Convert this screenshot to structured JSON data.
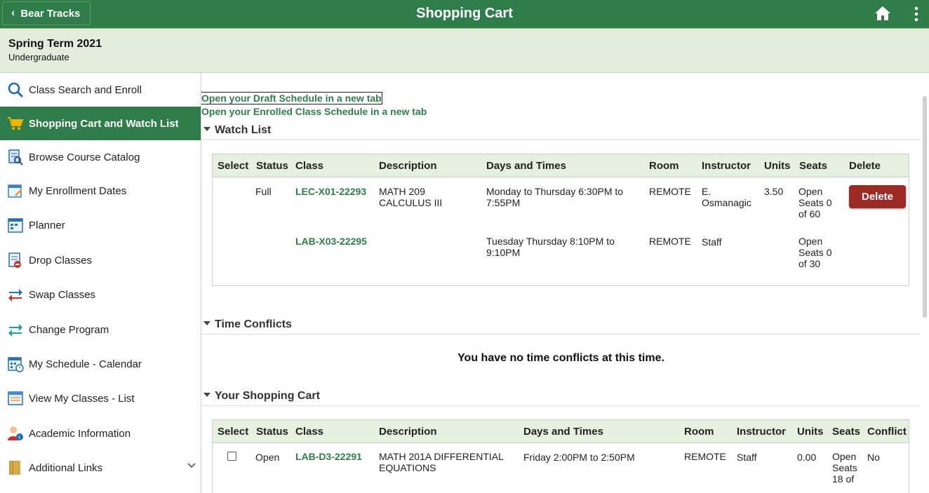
{
  "header": {
    "back_label": "Bear Tracks",
    "title": "Shopping Cart"
  },
  "term": {
    "name": "Spring Term 2021",
    "career": "Undergraduate"
  },
  "sidebar": {
    "items": [
      {
        "label": "Class Search and Enroll",
        "icon": "search-icon"
      },
      {
        "label": "Shopping Cart and Watch List",
        "icon": "shopping-cart-icon",
        "active": true
      },
      {
        "label": "Browse Course Catalog",
        "icon": "catalog-icon"
      },
      {
        "label": "My Enrollment Dates",
        "icon": "enrollment-dates-icon"
      },
      {
        "label": "Planner",
        "icon": "planner-icon"
      },
      {
        "label": "Drop Classes",
        "icon": "drop-classes-icon"
      },
      {
        "label": "Swap Classes",
        "icon": "swap-icon"
      },
      {
        "label": "Change Program",
        "icon": "change-program-icon"
      },
      {
        "label": "My Schedule - Calendar",
        "icon": "calendar-icon"
      },
      {
        "label": "View My Classes - List",
        "icon": "class-list-icon"
      },
      {
        "label": "Academic Information",
        "icon": "academic-info-icon"
      },
      {
        "label": "Additional Links",
        "icon": "folder-icon"
      }
    ]
  },
  "links": {
    "draft": "Open your Draft Schedule in a new tab",
    "enrolled": "Open your Enrolled Class Schedule in a new tab"
  },
  "watch_list": {
    "title": "Watch List",
    "columns": [
      "Select",
      "Status",
      "Class",
      "Description",
      "Days and Times",
      "Room",
      "Instructor",
      "Units",
      "Seats",
      "Delete"
    ],
    "rows": [
      {
        "status": "Full",
        "class": "LEC-X01-22293",
        "description": "MATH 209 CALCULUS III",
        "days_times": "Monday to Thursday  6:30PM to 7:55PM",
        "room": "REMOTE",
        "instructor": "E. Osmanagic",
        "units": "3.50",
        "seats": "Open Seats 0 of 60",
        "delete_label": "Delete"
      },
      {
        "status": "",
        "class": "LAB-X03-22295",
        "description": "",
        "days_times": "Tuesday Thursday   8:10PM to 9:10PM",
        "room": "REMOTE",
        "instructor": "Staff",
        "units": "",
        "seats": "Open Seats 0 of 30"
      }
    ]
  },
  "time_conflicts": {
    "title": "Time Conflicts",
    "message": "You have no time conflicts at this time."
  },
  "shopping_cart": {
    "title": "Your Shopping Cart",
    "columns": [
      "Select",
      "Status",
      "Class",
      "Description",
      "Days and Times",
      "Room",
      "Instructor",
      "Units",
      "Seats",
      "Conflict"
    ],
    "rows": [
      {
        "status": "Open",
        "class": "LAB-D3-22291",
        "description": "MATH 201A DIFFERENTIAL EQUATIONS",
        "days_times": "Friday   2:00PM to 2:50PM",
        "room": "REMOTE",
        "instructor": "Staff",
        "units": "0.00",
        "seats": "Open Seats 18 of",
        "conflict": "No"
      }
    ]
  }
}
